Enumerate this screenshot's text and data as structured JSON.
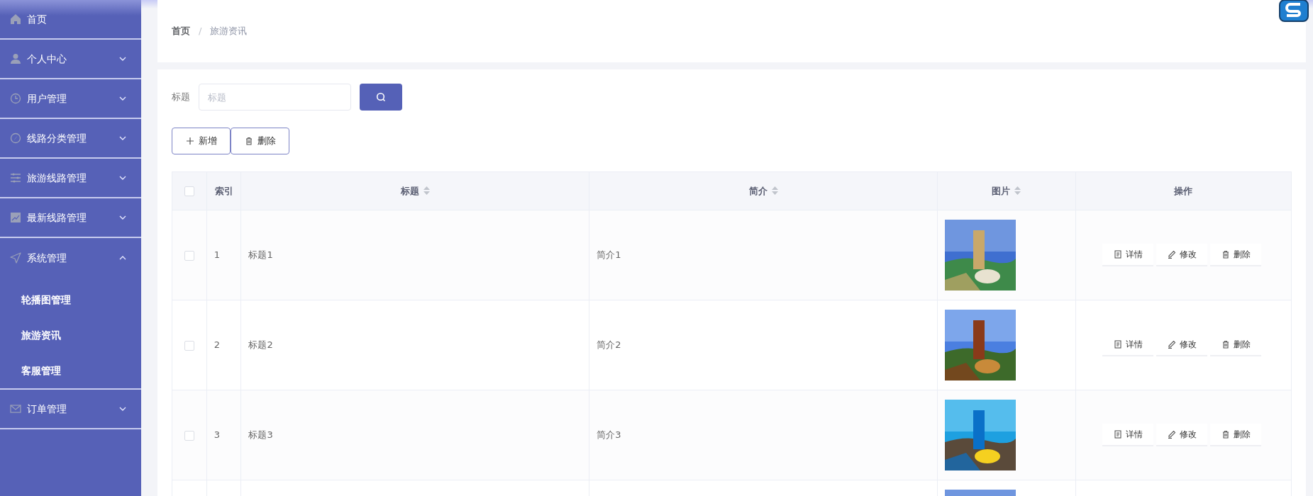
{
  "sidebar": {
    "items": [
      {
        "label": "首页"
      },
      {
        "label": "个人中心",
        "expanded": false
      },
      {
        "label": "用户管理",
        "expanded": false
      },
      {
        "label": "线路分类管理",
        "expanded": false
      },
      {
        "label": "旅游线路管理",
        "expanded": false
      },
      {
        "label": "最新线路管理",
        "expanded": false
      },
      {
        "label": "系统管理",
        "expanded": true,
        "children": [
          {
            "label": "轮播图管理"
          },
          {
            "label": "旅游资讯"
          },
          {
            "label": "客服管理"
          }
        ]
      },
      {
        "label": "订单管理",
        "expanded": false
      }
    ]
  },
  "breadcrumb": {
    "items": [
      "首页",
      "旅游资讯"
    ],
    "separator": "/"
  },
  "search": {
    "label": "标题",
    "placeholder": "标题"
  },
  "actions": [
    {
      "kind": "add",
      "label": "新增"
    },
    {
      "kind": "delete",
      "label": "删除"
    }
  ],
  "table": {
    "select_all": {
      "checked": false
    },
    "columns": [
      {
        "label": "索引",
        "sortable": false
      },
      {
        "label": "标题",
        "sortable": true
      },
      {
        "label": "简介",
        "sortable": true
      },
      {
        "label": "图片",
        "sortable": true
      },
      {
        "label": "操作",
        "sortable": false
      }
    ],
    "rows": [
      {
        "checked": false,
        "index": "1",
        "title": "标题1",
        "intro": "简介1",
        "image": {
          "kind": "picture"
        },
        "ops": [
          {
            "kind": "detail",
            "label": "详情"
          },
          {
            "kind": "edit",
            "label": "修改"
          },
          {
            "kind": "delete",
            "label": "删除"
          }
        ]
      },
      {
        "checked": false,
        "index": "2",
        "title": "标题2",
        "intro": "简介2",
        "image": {
          "kind": "picture"
        },
        "ops": [
          {
            "kind": "detail",
            "label": "详情"
          },
          {
            "kind": "edit",
            "label": "修改"
          },
          {
            "kind": "delete",
            "label": "删除"
          }
        ]
      },
      {
        "checked": false,
        "index": "3",
        "title": "标题3",
        "intro": "简介3",
        "image": {
          "kind": "picture"
        },
        "ops": [
          {
            "kind": "detail",
            "label": "详情"
          },
          {
            "kind": "edit",
            "label": "修改"
          },
          {
            "kind": "delete",
            "label": "删除"
          }
        ]
      },
      {
        "image": {
          "kind": "picture"
        }
      }
    ]
  }
}
